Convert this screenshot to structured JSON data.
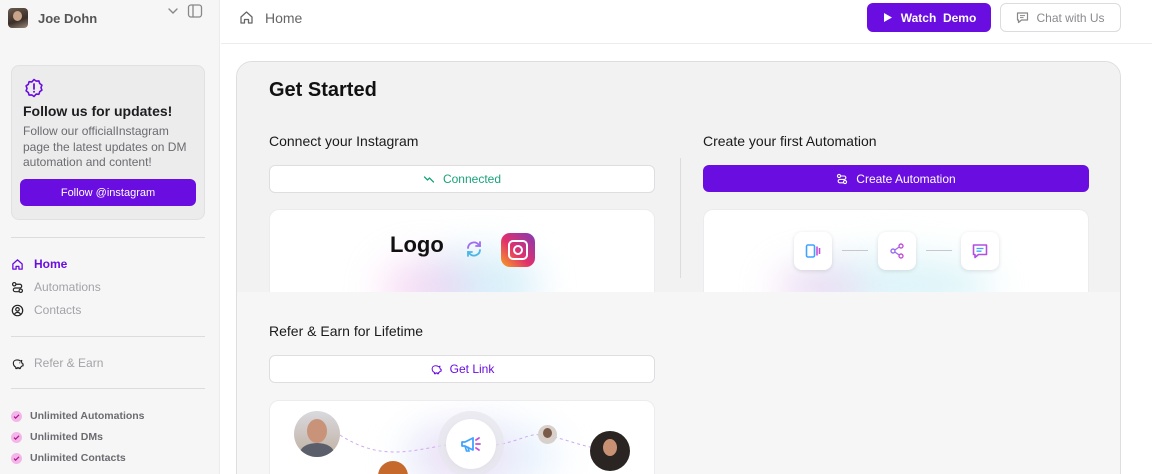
{
  "user": {
    "name": "Joe Dohn"
  },
  "follow_card": {
    "title": "Follow us for updates!",
    "description": "Follow our officialInstagram page the latest updates on DM automation and content!",
    "button_label": "Follow @instagram"
  },
  "nav": {
    "items": [
      {
        "label": "Home",
        "icon": "home-icon",
        "active": true
      },
      {
        "label": "Automations",
        "icon": "automations-icon",
        "active": false
      },
      {
        "label": "Contacts",
        "icon": "contacts-icon",
        "active": false
      }
    ],
    "refer": {
      "label": "Refer & Earn",
      "icon": "piggy-bank-icon"
    }
  },
  "features": [
    "Unlimited Automations",
    "Unlimited DMs",
    "Unlimited Contacts"
  ],
  "header": {
    "breadcrumb": "Home",
    "watch_demo_label": "Watch  Demo",
    "chat_label": "Chat with Us"
  },
  "main": {
    "title": "Get Started",
    "connect": {
      "label": "Connect your Instagram",
      "status": "Connected",
      "logo_text": "Logo"
    },
    "automation": {
      "label": "Create your first Automation",
      "button_label": "Create Automation"
    },
    "refer": {
      "label": "Refer & Earn for Lifetime",
      "button_label": "Get Link"
    }
  },
  "colors": {
    "brand": "#6a0de0",
    "connected": "#1aa37a"
  }
}
